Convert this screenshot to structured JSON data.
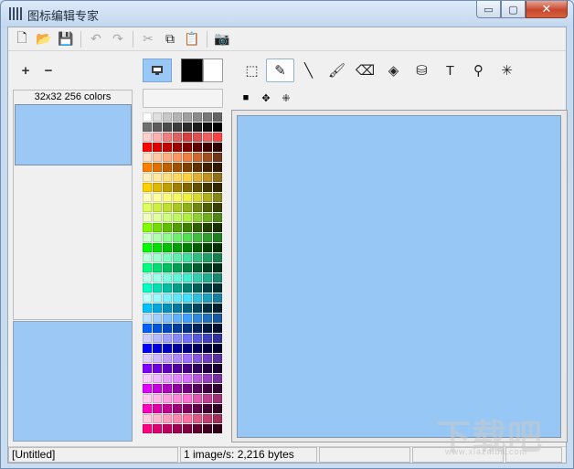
{
  "window": {
    "title": "图标编辑专家"
  },
  "window_buttons": {
    "minimize": "▭",
    "maximize": "▢",
    "close": "✕"
  },
  "toolbar": [
    {
      "name": "new-file-icon",
      "glyph": "🗋",
      "enabled": true
    },
    {
      "name": "open-folder-icon",
      "glyph": "📂",
      "enabled": true
    },
    {
      "name": "save-icon",
      "glyph": "💾",
      "enabled": true
    },
    {
      "name": "undo-icon",
      "glyph": "↶",
      "enabled": false
    },
    {
      "name": "redo-icon",
      "glyph": "↷",
      "enabled": false
    },
    {
      "name": "cut-icon",
      "glyph": "✂",
      "enabled": false
    },
    {
      "name": "copy-icon",
      "glyph": "⧉",
      "enabled": true
    },
    {
      "name": "paste-icon",
      "glyph": "📋",
      "enabled": false
    },
    {
      "name": "camera-icon",
      "glyph": "📷",
      "enabled": true
    }
  ],
  "zoom": {
    "zoom_in": "+",
    "zoom_out": "−"
  },
  "format": {
    "label": "32x32 256 colors"
  },
  "colors": {
    "foreground": "#000000",
    "background": "#ffffff",
    "canvas": "#97c7f5"
  },
  "tools": [
    {
      "name": "select-rect-icon",
      "glyph": "⬚",
      "active": false
    },
    {
      "name": "pencil-icon",
      "glyph": "✎",
      "active": true
    },
    {
      "name": "line-icon",
      "glyph": "╲",
      "active": false
    },
    {
      "name": "brush-icon",
      "glyph": "🖌",
      "active": false
    },
    {
      "name": "eraser-icon",
      "glyph": "⌫",
      "active": false
    },
    {
      "name": "fill-shapes-icon",
      "glyph": "◈",
      "active": false
    },
    {
      "name": "paint-bucket-icon",
      "glyph": "⛁",
      "active": false
    },
    {
      "name": "text-tool-icon",
      "glyph": "T",
      "active": false
    },
    {
      "name": "eyedropper-icon",
      "glyph": "⚲",
      "active": false
    },
    {
      "name": "magic-wand-icon",
      "glyph": "✳",
      "active": false
    }
  ],
  "brushes": [
    {
      "name": "brush-size-square-icon",
      "glyph": "■"
    },
    {
      "name": "brush-size-diamond-icon",
      "glyph": "✥"
    },
    {
      "name": "brush-size-cross-icon",
      "glyph": "⁜"
    }
  ],
  "palette": [
    "#ffffff",
    "#e0e0e0",
    "#c8c8c8",
    "#b4b4b4",
    "#a0a0a0",
    "#8c8c8c",
    "#787878",
    "#646464",
    "#707070",
    "#5c5c5c",
    "#4c4c4c",
    "#3c3c3c",
    "#2c2c2c",
    "#1c1c1c",
    "#0e0e0e",
    "#000000",
    "#ffd0d0",
    "#ffb0b0",
    "#f08080",
    "#e06060",
    "#d84040",
    "#e05050",
    "#f06060",
    "#ff4040",
    "#ff0000",
    "#e00000",
    "#c00000",
    "#a00000",
    "#800000",
    "#600000",
    "#400000",
    "#300000",
    "#ffe0c8",
    "#ffc8a0",
    "#ffb080",
    "#ff9860",
    "#f08040",
    "#d06830",
    "#a05020",
    "#703818",
    "#ff8000",
    "#e07000",
    "#c06000",
    "#a05000",
    "#804000",
    "#603000",
    "#402000",
    "#301800",
    "#fff0c0",
    "#ffe8a0",
    "#ffe080",
    "#ffd860",
    "#ffd040",
    "#e0b030",
    "#c09020",
    "#907018",
    "#ffd000",
    "#e0b800",
    "#c0a000",
    "#a08000",
    "#806800",
    "#605000",
    "#403800",
    "#302800",
    "#ffffc0",
    "#ffffa0",
    "#ffff80",
    "#f8f860",
    "#f0f040",
    "#d8d830",
    "#b0b020",
    "#888818",
    "#e0ff60",
    "#d0f040",
    "#c0e030",
    "#a8c820",
    "#90b018",
    "#708810",
    "#506008",
    "#384004",
    "#f0ffc0",
    "#e0ffa0",
    "#d0ff80",
    "#c0f860",
    "#b0f040",
    "#90d030",
    "#70b020",
    "#508818",
    "#80ff00",
    "#70e000",
    "#60c000",
    "#50a000",
    "#408000",
    "#306000",
    "#204000",
    "#183000",
    "#d0ffd0",
    "#b0ffb0",
    "#90ff90",
    "#70f070",
    "#50e050",
    "#40c040",
    "#30a030",
    "#208020",
    "#00ff00",
    "#00e000",
    "#00c000",
    "#00a000",
    "#008000",
    "#006000",
    "#004000",
    "#003000",
    "#c0ffe0",
    "#a0ffd0",
    "#80ffc0",
    "#60f0b0",
    "#40e0a0",
    "#30c080",
    "#20a068",
    "#188050",
    "#00ff80",
    "#00e070",
    "#00c060",
    "#00a050",
    "#008040",
    "#006030",
    "#004020",
    "#003018",
    "#c0fff0",
    "#a0ffe8",
    "#80ffe0",
    "#60f8d8",
    "#40f0d0",
    "#30d0b0",
    "#20b090",
    "#188870",
    "#00ffc0",
    "#00e0b0",
    "#00c0a0",
    "#00a088",
    "#008070",
    "#006058",
    "#004040",
    "#003030",
    "#c0ffff",
    "#a0f8ff",
    "#80f0ff",
    "#60e8ff",
    "#40e0ff",
    "#30c0e0",
    "#20a0c0",
    "#1880a0",
    "#00c0ff",
    "#00a8e0",
    "#0090c0",
    "#0078a0",
    "#006080",
    "#004860",
    "#003040",
    "#002030",
    "#c0e0ff",
    "#a0d0ff",
    "#80c0ff",
    "#60b0ff",
    "#40a0ff",
    "#3088e0",
    "#2070c0",
    "#1858a0",
    "#0060ff",
    "#0054e0",
    "#0048c0",
    "#003ca0",
    "#003080",
    "#002460",
    "#001840",
    "#001030",
    "#d0d0ff",
    "#b8b8ff",
    "#a0a0ff",
    "#8888ff",
    "#7070ff",
    "#5858e0",
    "#4040c0",
    "#3030a0",
    "#0000ff",
    "#0000e0",
    "#0000c0",
    "#0000a0",
    "#000080",
    "#000060",
    "#000040",
    "#000030",
    "#e0d0ff",
    "#d0b8ff",
    "#c0a0ff",
    "#b088ff",
    "#a070ff",
    "#8858e0",
    "#7040c0",
    "#5830a0",
    "#8000ff",
    "#7000e0",
    "#6000c0",
    "#5000a0",
    "#400080",
    "#300060",
    "#200040",
    "#180030",
    "#f8d0ff",
    "#f0b8ff",
    "#e8a0ff",
    "#e088ff",
    "#d870ff",
    "#b858e0",
    "#9840c0",
    "#7830a0",
    "#e000ff",
    "#c800e0",
    "#b000c0",
    "#9000a0",
    "#700080",
    "#580060",
    "#400040",
    "#300030",
    "#ffd0f0",
    "#ffb8e8",
    "#ffa0e0",
    "#ff88d8",
    "#ff70d0",
    "#e058b0",
    "#c04090",
    "#a03078",
    "#ff00c0",
    "#e000a8",
    "#c00090",
    "#a00078",
    "#800060",
    "#600048",
    "#400030",
    "#300024",
    "#ffd0e0",
    "#ffb8d0",
    "#ffa0c0",
    "#ff88b0",
    "#ff70a0",
    "#e05888",
    "#c04070",
    "#a03058",
    "#ff0080",
    "#e00070",
    "#c00060",
    "#a00050",
    "#800040",
    "#600030",
    "#400020",
    "#300018"
  ],
  "status": {
    "file": "[Untitled]",
    "info": "1 image/s: 2,216 bytes",
    "extra1": "",
    "extra2": "",
    "extra3": ""
  },
  "watermark": {
    "text": "下载吧",
    "sub": "www.xiazaiba.com"
  }
}
